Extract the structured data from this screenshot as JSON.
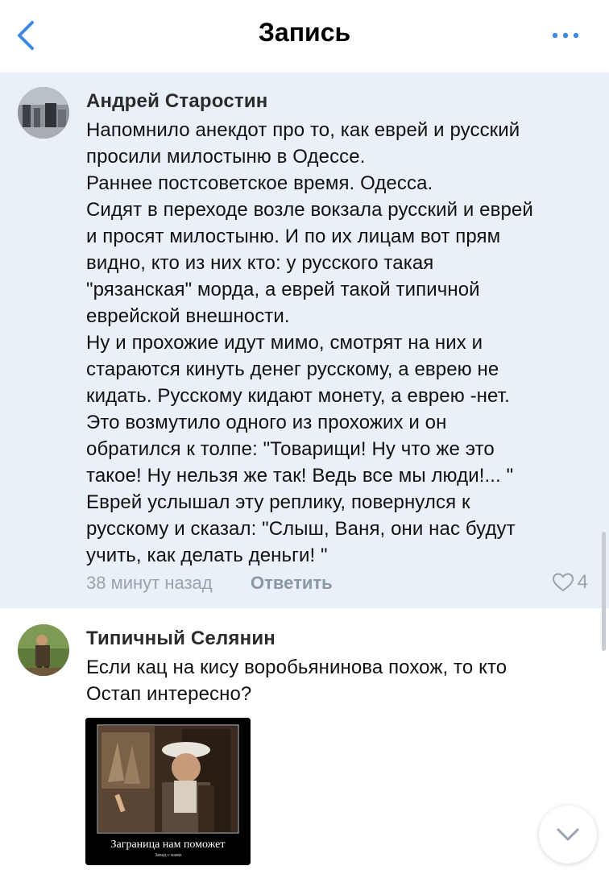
{
  "header": {
    "title": "Запись"
  },
  "comments": [
    {
      "author": "Андрей Старостин",
      "text": "Напомнило анекдот про то, как еврей и русский\nпросили милостыню в Одессе.\nРаннее постсоветское время. Одесса.\nСидят в переходе возле вокзала русский и еврей\nи просят милостыню. И по их лицам вот прям\nвидно, кто из них кто: у русского такая\n\"рязанская\" морда, а еврей такой типичной\nеврейской внешности.\nНу и прохожие идут мимо, смотрят на них и\nстараются кинуть денег русскому, а еврею не\nкидать. Русскому кидают монету, а еврею -нет.\nЭто возмутило одного из прохожих и он\nобратился к толпе: \"Товарищи! Ну что же это\nтакое! Ну нельзя же так! Ведь все мы люди!... \"\nЕврей услышал эту реплику, повернулся к\nрусскому и сказал: \"Слыш, Ваня, они нас будут\nучить, как делать деньги! \"",
      "time": "38 минут назад",
      "reply_label": "Ответить",
      "likes": "4"
    },
    {
      "author": "Типичный Селянин",
      "text": "Если кац  на кису воробьянинова похож, то кто\nОстап интересно?",
      "attachment": {
        "caption": "Заграница нам поможет",
        "subcaption": "Запад с нами"
      }
    }
  ],
  "colors": {
    "highlight_bg": "#eaf0f8",
    "accent": "#3f8ae0",
    "muted": "#9aa3ad"
  }
}
